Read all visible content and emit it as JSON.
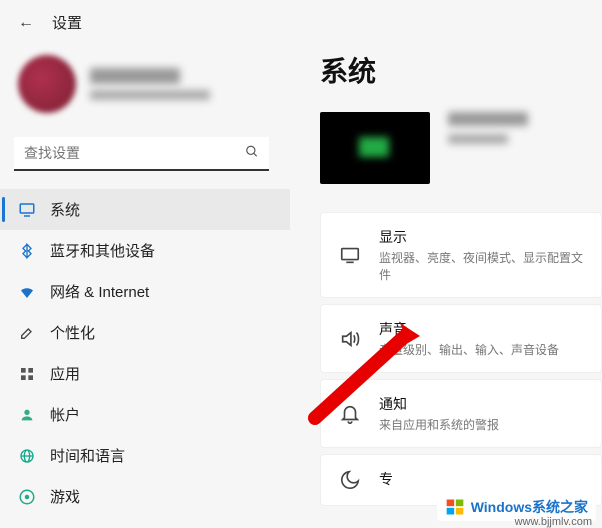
{
  "header": {
    "title": "设置"
  },
  "search": {
    "placeholder": "查找设置"
  },
  "sidebar": {
    "items": [
      {
        "label": "系统",
        "icon": "monitor"
      },
      {
        "label": "蓝牙和其他设备",
        "icon": "bluetooth"
      },
      {
        "label": "网络 & Internet",
        "icon": "wifi"
      },
      {
        "label": "个性化",
        "icon": "brush"
      },
      {
        "label": "应用",
        "icon": "apps"
      },
      {
        "label": "帐户",
        "icon": "person"
      },
      {
        "label": "时间和语言",
        "icon": "globe"
      },
      {
        "label": "游戏",
        "icon": "game"
      }
    ]
  },
  "main": {
    "title": "系统",
    "settings": [
      {
        "title": "显示",
        "sub": "监视器、亮度、夜间模式、显示配置文件",
        "icon": "display"
      },
      {
        "title": "声音",
        "sub": "音量级别、输出、输入、声音设备",
        "icon": "sound"
      },
      {
        "title": "通知",
        "sub": "来自应用和系统的警报",
        "icon": "bell"
      },
      {
        "title": "专",
        "sub": "",
        "icon": "moon"
      }
    ]
  },
  "watermark": {
    "text": "Windows系统之家",
    "url": "www.bjjmlv.com"
  }
}
